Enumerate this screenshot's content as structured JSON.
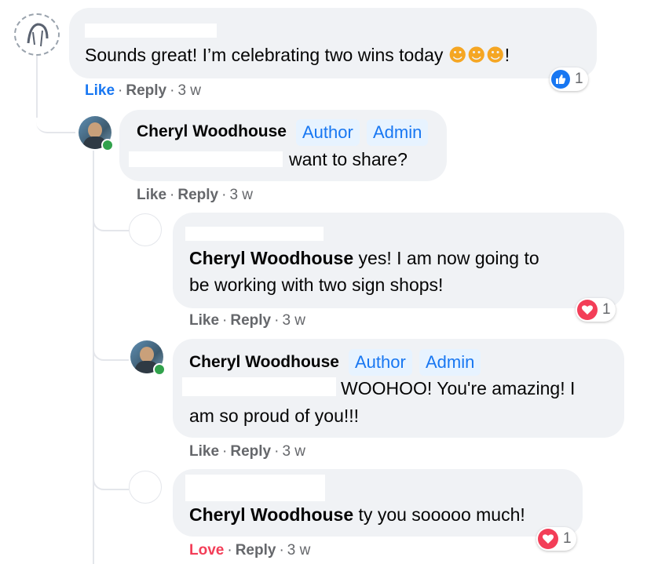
{
  "comments": [
    {
      "author": "",
      "text": "Sounds great! I’m celebrating two wins today",
      "emoji": [
        "😊",
        "😊",
        "😊"
      ],
      "trailing": "!",
      "like_label": "Like",
      "reply_label": "Reply",
      "time": "3 w",
      "reaction": {
        "type": "like",
        "count": "1"
      }
    },
    {
      "author": "Cheryl Woodhouse",
      "badges": [
        "Author",
        "Admin"
      ],
      "text": "want to share?",
      "like_label": "Like",
      "reply_label": "Reply",
      "time": "3 w"
    },
    {
      "author": "",
      "mention": "Cheryl Woodhouse",
      "text_line1": "yes! I am now going to",
      "text_line2": "be working with two sign shops!",
      "like_label": "Like",
      "reply_label": "Reply",
      "time": "3 w",
      "reaction": {
        "type": "love",
        "count": "1"
      }
    },
    {
      "author": "Cheryl Woodhouse",
      "badges": [
        "Author",
        "Admin"
      ],
      "text_line1": "WOOHOO! You're amazing! I",
      "text_line2": "am so proud of you!!!",
      "like_label": "Like",
      "reply_label": "Reply",
      "time": "3 w"
    },
    {
      "author": "",
      "mention": "Cheryl Woodhouse",
      "text": "ty you sooooo much!",
      "like_label": "Love",
      "reply_label": "Reply",
      "time": "3 w",
      "reaction": {
        "type": "love",
        "count": "1"
      }
    }
  ],
  "colors": {
    "bubble": "#f0f2f5",
    "link_blue": "#1877f2",
    "love_red": "#f33e58",
    "meta_gray": "#65676b",
    "badge_bg": "#e7f3ff",
    "online_green": "#31a24c"
  }
}
